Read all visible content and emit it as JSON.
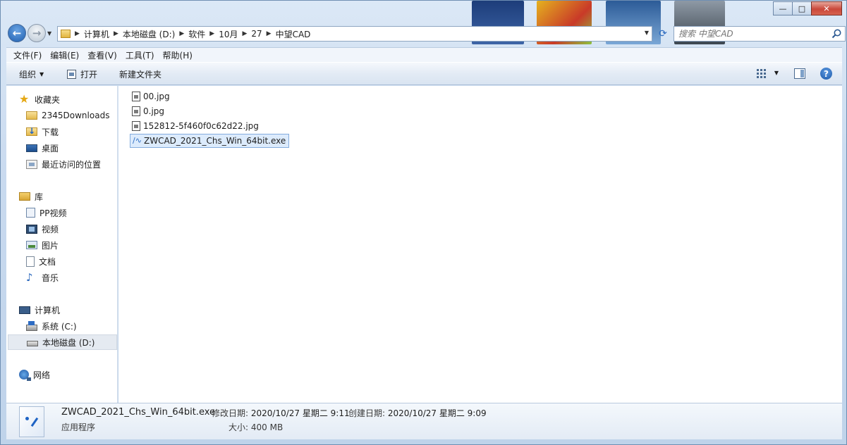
{
  "window": {
    "controls": {
      "minimize": "—",
      "maximize": "□",
      "close": "✕"
    }
  },
  "nav": {
    "back_icon": "back-arrow-icon",
    "forward_icon": "forward-arrow-icon"
  },
  "address": {
    "crumbs": [
      "计算机",
      "本地磁盘 (D:)",
      "软件",
      "10月",
      "27",
      "中望CAD"
    ]
  },
  "search": {
    "placeholder": "搜索 中望CAD"
  },
  "menubar": {
    "items": [
      "文件(F)",
      "编辑(E)",
      "查看(V)",
      "工具(T)",
      "帮助(H)"
    ]
  },
  "toolbar": {
    "organize": "组织",
    "open": "打开",
    "new_folder": "新建文件夹",
    "help": "?"
  },
  "sidebar": {
    "favorites": {
      "label": "收藏夹",
      "items": [
        "2345Downloads",
        "下载",
        "桌面",
        "最近访问的位置"
      ]
    },
    "libraries": {
      "label": "库",
      "items": [
        "PP视频",
        "视频",
        "图片",
        "文档",
        "音乐"
      ]
    },
    "computer": {
      "label": "计算机",
      "items": [
        "系统 (C:)",
        "本地磁盘 (D:)"
      ]
    },
    "network": {
      "label": "网络"
    }
  },
  "files": [
    {
      "name": "00.jpg",
      "icon": "jpg-file-icon"
    },
    {
      "name": "0.jpg",
      "icon": "jpg-file-icon"
    },
    {
      "name": "152812-5f460f0c62d22.jpg",
      "icon": "jpg-file-icon"
    },
    {
      "name": "ZWCAD_2021_Chs_Win_64bit.exe",
      "icon": "exe-file-icon",
      "selected": true
    }
  ],
  "details": {
    "name": "ZWCAD_2021_Chs_Win_64bit.exe",
    "type": "应用程序",
    "modified_label": "修改日期:",
    "modified_value": "2020/10/27 星期二 9:11",
    "created_label": "创建日期:",
    "created_value": "2020/10/27 星期二 9:09",
    "size_label": "大小:",
    "size_value": "400 MB"
  },
  "colors": {
    "selection": "#dcebfc",
    "accent": "#1e63c4"
  }
}
